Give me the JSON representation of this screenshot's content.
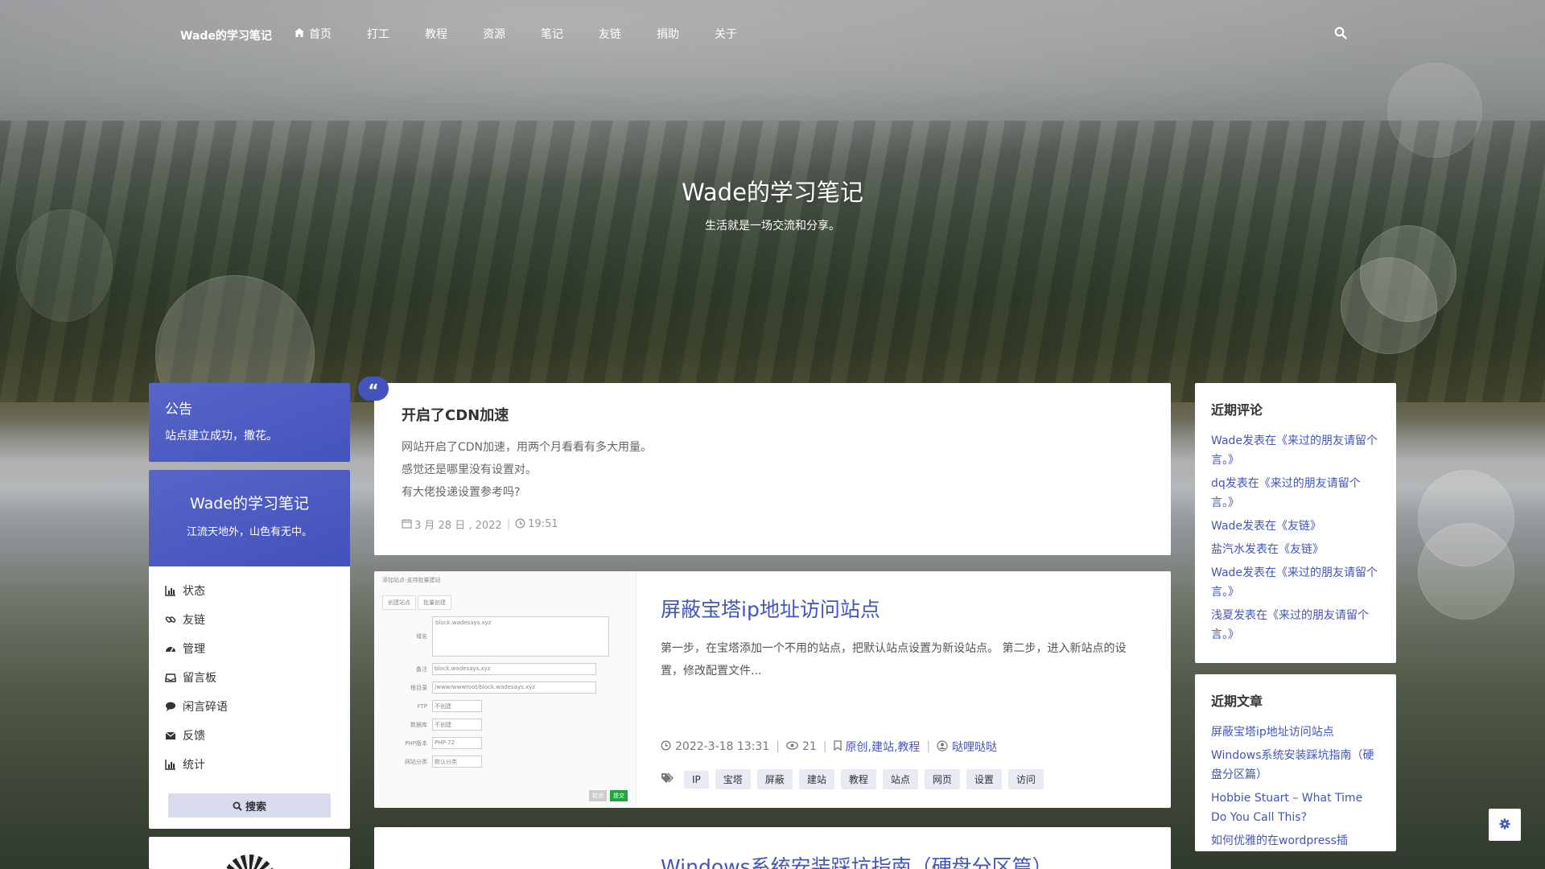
{
  "site": {
    "brand": "Wade的学习笔记",
    "hero_title": "Wade的学习笔记",
    "hero_subtitle": "生活就是一场交流和分享。"
  },
  "nav": {
    "items": [
      {
        "label": "首页",
        "icon": "home-icon"
      },
      {
        "label": "打工"
      },
      {
        "label": "教程"
      },
      {
        "label": "资源"
      },
      {
        "label": "笔记"
      },
      {
        "label": "友链"
      },
      {
        "label": "捐助"
      },
      {
        "label": "关于"
      }
    ],
    "search_icon": "search-icon"
  },
  "notice": {
    "title": "公告",
    "text": "站点建立成功，撒花。"
  },
  "profile": {
    "name": "Wade的学习笔记",
    "desc": "江流天地外，山色有无中。"
  },
  "side_menu": [
    {
      "label": "状态",
      "icon": "bar-chart-icon"
    },
    {
      "label": "友链",
      "icon": "link-icon"
    },
    {
      "label": "管理",
      "icon": "dashboard-icon"
    },
    {
      "label": "留言板",
      "icon": "inbox-icon"
    },
    {
      "label": "闲言碎语",
      "icon": "comment-icon"
    },
    {
      "label": "反馈",
      "icon": "envelope-icon"
    },
    {
      "label": "统计",
      "icon": "bar-chart-icon"
    }
  ],
  "search_button": "搜索",
  "memo": {
    "title": "开启了CDN加速",
    "lines": [
      "网站开启了CDN加速，用两个月看看有多大用量。",
      "感觉还是哪里没有设置对。",
      "有大佬投递设置参考吗?"
    ],
    "date": "3 月 28 日 , 2022",
    "time": "19:51"
  },
  "post": {
    "title": "屏蔽宝塔ip地址访问站点",
    "excerpt": "第一步，在宝塔添加一个不用的站点，把默认站点设置为新设站点。 第二步，进入新站点的设置，修改配置文件...",
    "datetime": "2022-3-18 13:31",
    "views": "21",
    "categories": "原创,建站,教程",
    "author": "哒哩哒哒",
    "tags": [
      "IP",
      "宝塔",
      "屏蔽",
      "建站",
      "教程",
      "站点",
      "网页",
      "设置",
      "访问"
    ],
    "thumb": {
      "header": "添加站点-支持批量建站",
      "tab1": "创建站点",
      "tab2": "批量创建",
      "fields": [
        {
          "label": "域名",
          "value": "block.wadesays.xyz"
        },
        {
          "label": "备注",
          "value": "block.wadesays.xyz"
        },
        {
          "label": "根目录",
          "value": "/www/wwwroot/block.wadesays.xyz"
        },
        {
          "label": "FTP",
          "value": "不创建"
        },
        {
          "label": "数据库",
          "value": "不创建"
        },
        {
          "label": "PHP版本",
          "value": "PHP-72"
        },
        {
          "label": "网站分类",
          "value": "默认分类"
        }
      ],
      "cancel": "取消",
      "submit": "提交"
    }
  },
  "next_post": {
    "title": "Windows系统安装踩坑指南（硬盘分区篇）"
  },
  "recent_comments": {
    "title": "近期评论",
    "items": [
      "Wade发表在《来过的朋友请留个言。》",
      "dq发表在《来过的朋友请留个言。》",
      "Wade发表在《友链》",
      "盐汽水发表在《友链》",
      "Wade发表在《来过的朋友请留个言。》",
      "浅夏发表在《来过的朋友请留个言。》"
    ]
  },
  "recent_posts": {
    "title": "近期文章",
    "items": [
      "屏蔽宝塔ip地址访问站点",
      "Windows系统安装踩坑指南（硬盘分区篇）",
      "Hobbie Stuart – What Time Do You Call This?",
      "如何优雅的在wordpress插"
    ]
  },
  "colors": {
    "accent": "#4354bd",
    "notice_bg": "#5865c9",
    "tag_bg": "#e8eaf4"
  }
}
